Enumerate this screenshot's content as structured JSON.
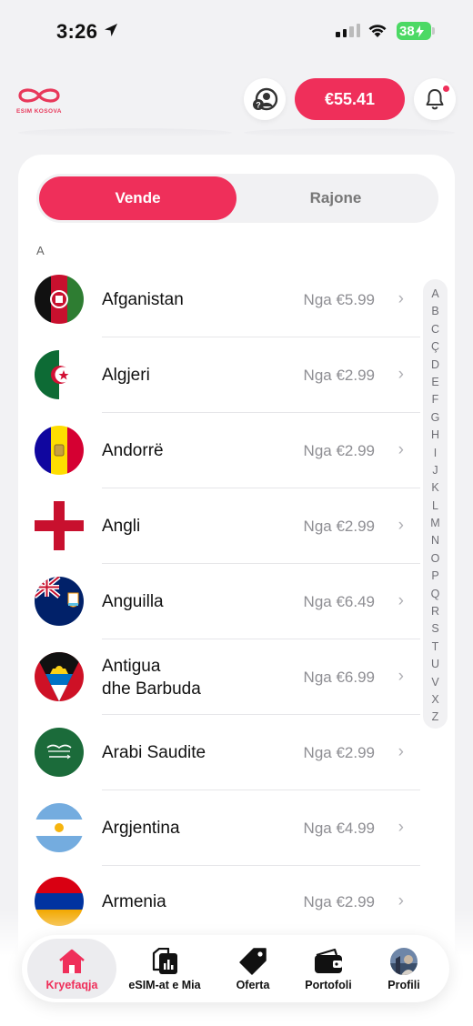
{
  "status_bar": {
    "time": "3:26",
    "battery": "38"
  },
  "header": {
    "logo_text": "ESIM KOSOVA",
    "balance": "€55.41",
    "accent_color": "#ef2f5a"
  },
  "segments": {
    "active": "Vende",
    "inactive": "Rajone"
  },
  "section_letter": "A",
  "countries": [
    {
      "name": "Afganistan",
      "price": "Nga €5.99",
      "flag": "afghanistan-flag-icon"
    },
    {
      "name": "Algjeri",
      "price": "Nga €2.99",
      "flag": "algeria-flag-icon"
    },
    {
      "name": "Andorrë",
      "price": "Nga €2.99",
      "flag": "andorra-flag-icon"
    },
    {
      "name": "Angli",
      "price": "Nga €2.99",
      "flag": "england-flag-icon"
    },
    {
      "name": "Anguilla",
      "price": "Nga €6.49",
      "flag": "anguilla-flag-icon"
    },
    {
      "name_line1": "Antigua",
      "name_line2": "dhe Barbuda",
      "price": "Nga €6.99",
      "flag": "antigua-barbuda-flag-icon"
    },
    {
      "name": "Arabi Saudite",
      "price": "Nga €2.99",
      "flag": "saudi-arabia-flag-icon"
    },
    {
      "name": "Argjentina",
      "price": "Nga €4.99",
      "flag": "argentina-flag-icon"
    },
    {
      "name": "Armenia",
      "price": "Nga €2.99",
      "flag": "armenia-flag-icon"
    }
  ],
  "index_letters": [
    "A",
    "B",
    "C",
    "Ç",
    "D",
    "E",
    "F",
    "G",
    "H",
    "I",
    "J",
    "K",
    "L",
    "M",
    "N",
    "O",
    "P",
    "Q",
    "R",
    "S",
    "T",
    "U",
    "V",
    "X",
    "Z"
  ],
  "tabs": [
    {
      "label": "Kryefaqja",
      "icon": "home-icon",
      "active": true
    },
    {
      "label": "eSIM-at e Mia",
      "icon": "sim-card-icon",
      "active": false
    },
    {
      "label": "Oferta",
      "icon": "tag-icon",
      "active": false
    },
    {
      "label": "Portofoli",
      "icon": "wallet-icon",
      "active": false
    },
    {
      "label": "Profili",
      "icon": "avatar-icon",
      "active": false
    }
  ]
}
